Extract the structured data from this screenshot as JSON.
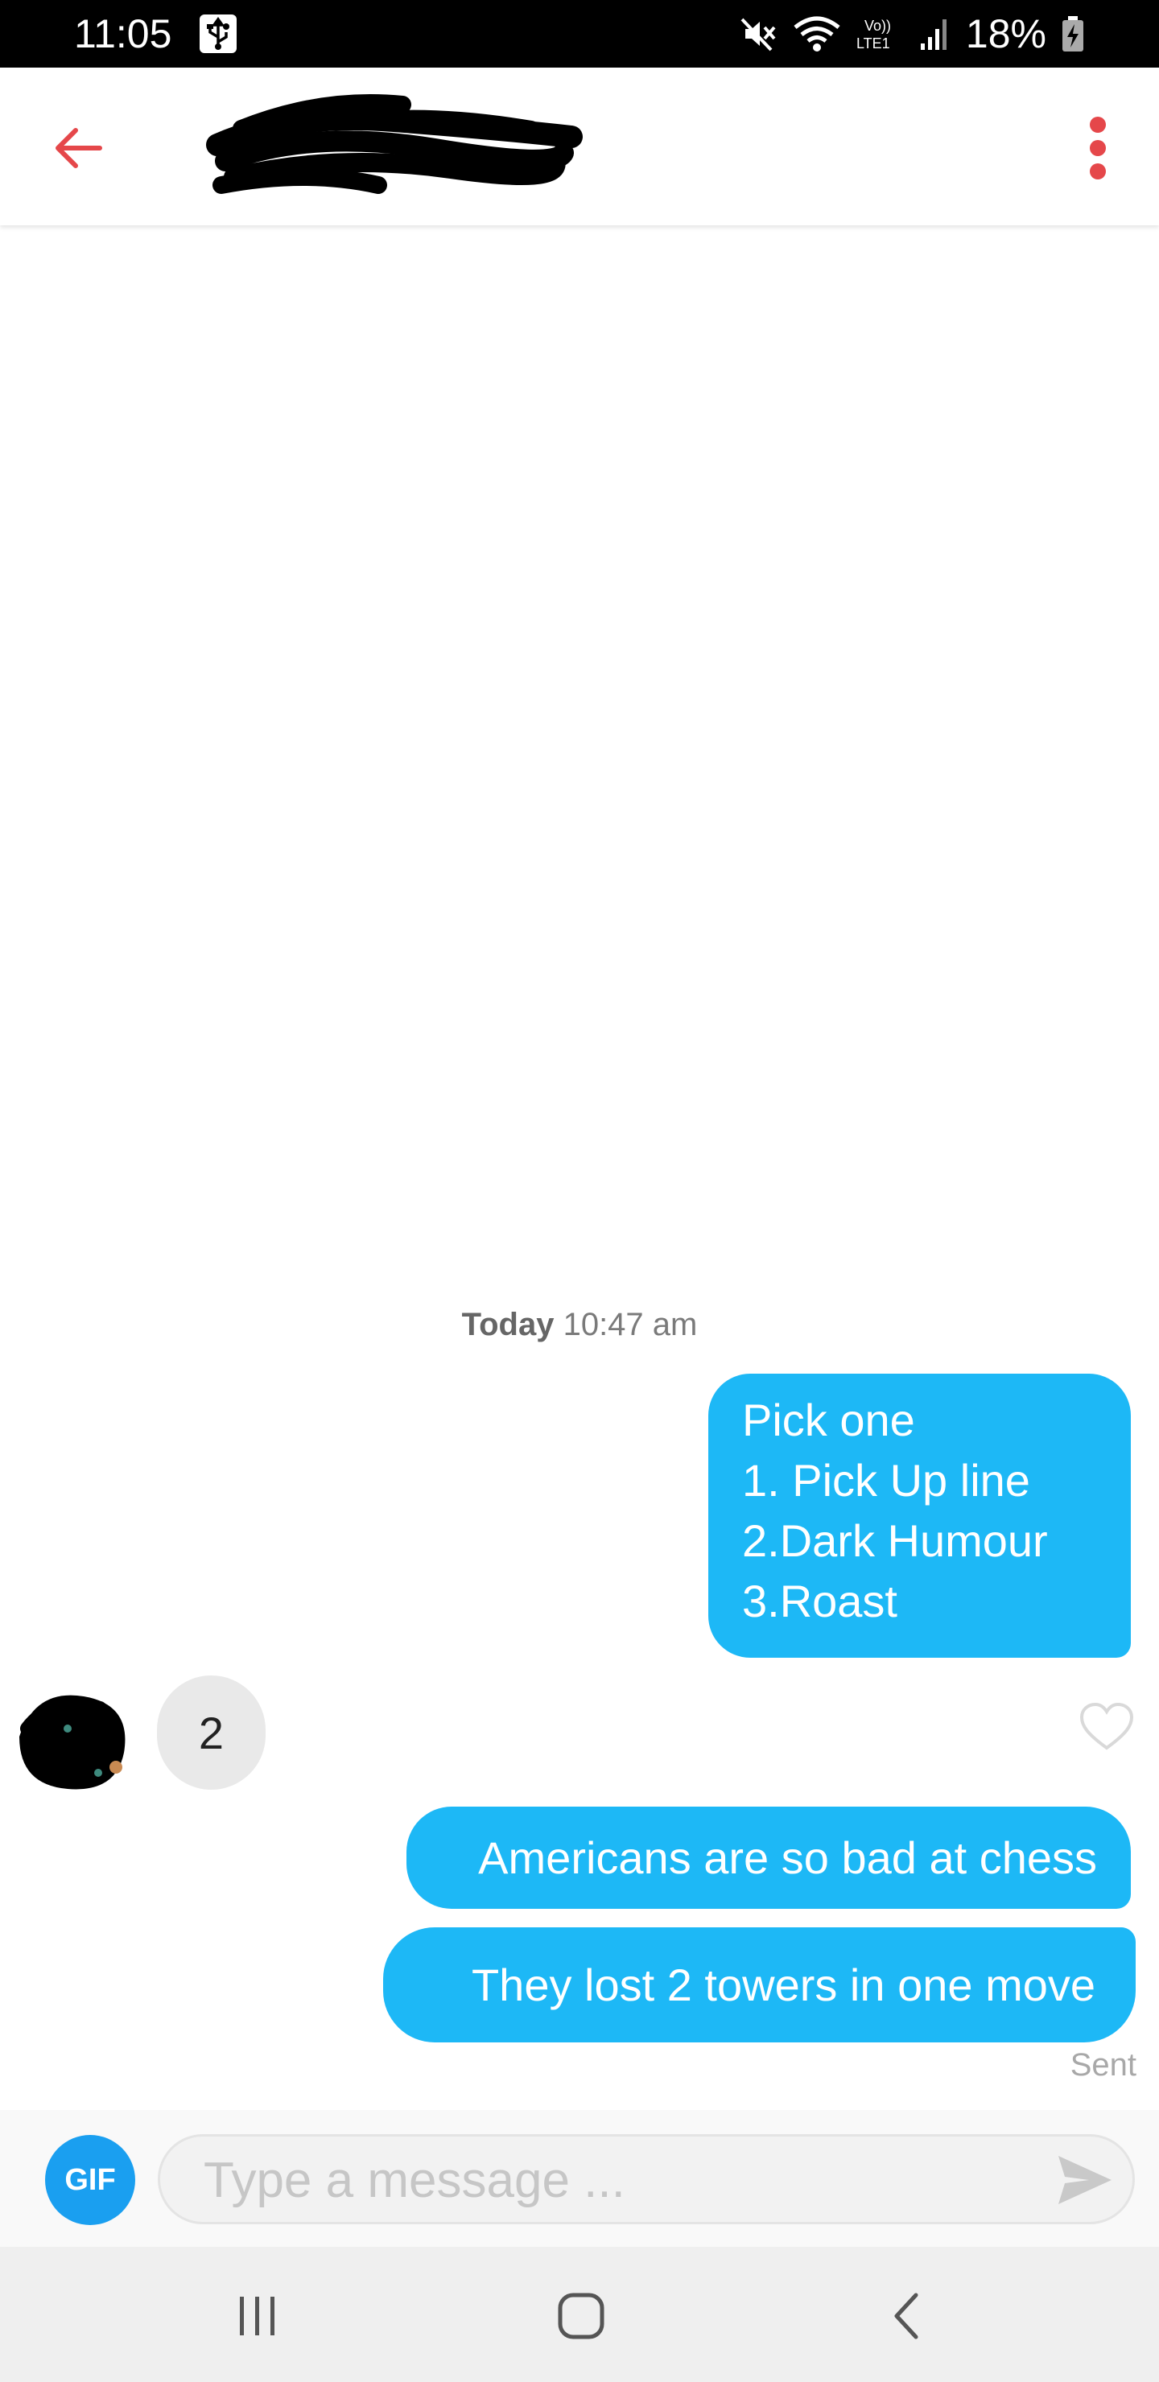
{
  "status_bar": {
    "time": "11:05",
    "battery": "18%",
    "icons": [
      "usb-icon",
      "mute-icon",
      "wifi-icon",
      "volte-lte-icon",
      "signal-icon",
      "battery-charging-icon"
    ]
  },
  "header": {
    "back_icon": "arrow-left-icon",
    "more_icon": "vertical-dots-icon",
    "accent_color": "#e5474a"
  },
  "chat": {
    "timestamp_day": "Today",
    "timestamp_time": "10:47 am",
    "messages": [
      {
        "from": "me",
        "text": "Pick one\n1. Pick Up line\n2.Dark Humour\n3.Roast"
      },
      {
        "from": "them",
        "text": "2"
      },
      {
        "from": "me",
        "text": "Americans are so bad at chess"
      },
      {
        "from": "me",
        "text": "They lost 2 towers in one move"
      }
    ],
    "status": "Sent",
    "bubble_color": "#1db8f6"
  },
  "composer": {
    "gif_label": "GIF",
    "placeholder": "Type a message ...",
    "value": "",
    "send_icon": "send-icon"
  },
  "nav_bar": {
    "icons": [
      "recent-apps-icon",
      "home-icon",
      "back-chevron-icon"
    ]
  }
}
